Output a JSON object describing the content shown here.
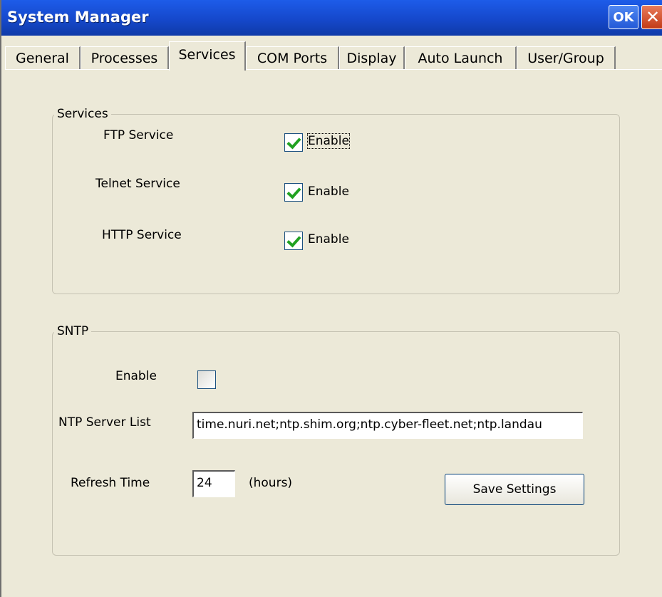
{
  "window": {
    "title": "System Manager",
    "ok_label": "OK",
    "close_label": "✕"
  },
  "tabs": [
    {
      "label": "General"
    },
    {
      "label": "Processes"
    },
    {
      "label": "Services"
    },
    {
      "label": "COM Ports"
    },
    {
      "label": "Display"
    },
    {
      "label": "Auto Launch"
    },
    {
      "label": "User/Group"
    }
  ],
  "active_tab": "Services",
  "services": {
    "group_label": "Services",
    "items": [
      {
        "label": "FTP Service",
        "checkbox_label": "Enable",
        "checked": true
      },
      {
        "label": "Telnet Service",
        "checkbox_label": "Enable",
        "checked": true
      },
      {
        "label": "HTTP Service",
        "checkbox_label": "Enable",
        "checked": true
      }
    ]
  },
  "sntp": {
    "group_label": "SNTP",
    "enable_label": "Enable",
    "enable_checked": false,
    "server_list_label": "NTP Server List",
    "server_list_value": "time.nuri.net;ntp.shim.org;ntp.cyber-fleet.net;ntp.landau",
    "refresh_label": "Refresh Time",
    "refresh_value": "24",
    "refresh_unit": "(hours)",
    "save_button": "Save Settings"
  },
  "colors": {
    "titlebar": "#1548cb",
    "window_bg": "#ece9d8",
    "checkmark": "#21a121",
    "close_button": "#c23b17"
  }
}
